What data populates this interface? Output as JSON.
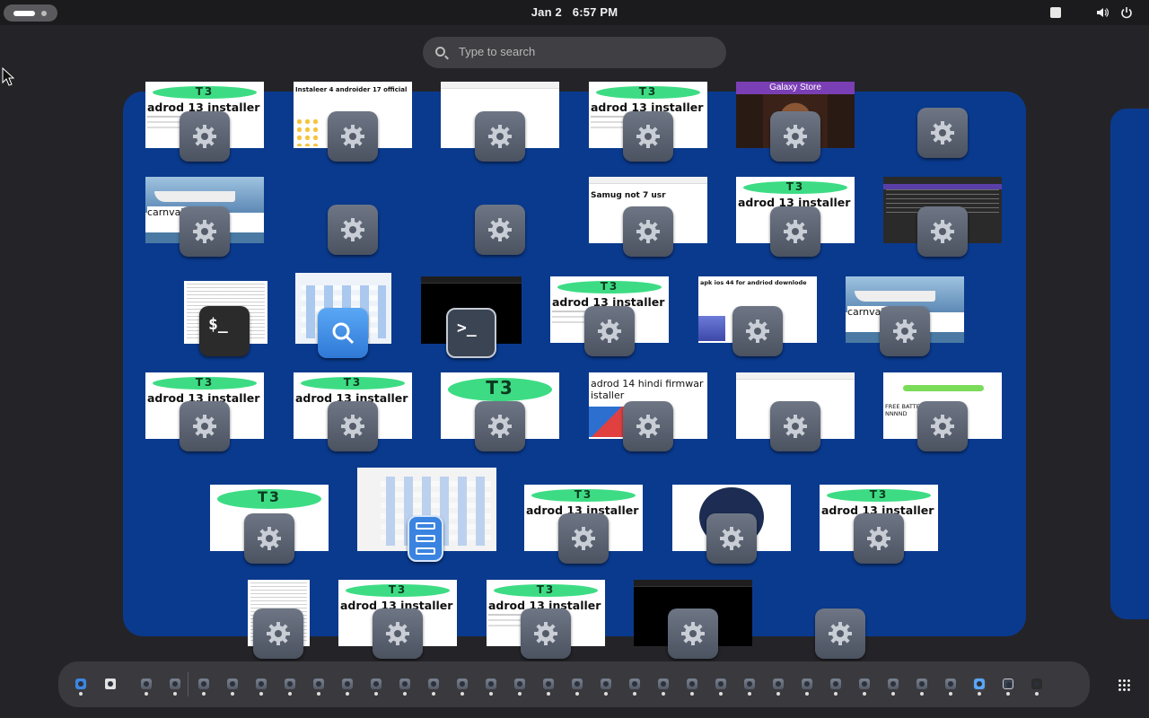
{
  "topbar": {
    "date": "Jan 2",
    "time": "6:57 PM",
    "tray_icons": [
      "keyboard-icon",
      "volume-icon",
      "power-icon"
    ]
  },
  "search": {
    "placeholder": "Type to search"
  },
  "windows": {
    "installer_title": "adrod 13 installer",
    "t13_logo": "T3",
    "w_r1c2": "Instaleer 4 androider 17 official",
    "w_galaxy": "Galaxy Store",
    "w_carnival": "carnval fr",
    "w_samsung": "Samug not 7 usr",
    "w_apk": "apk ios 44 for andriod downlode",
    "w_hindi": "adrod 14 hindi firmwar istaller",
    "w_battery": "FREE BATTE NNNND"
  },
  "colors": {
    "workspace": "#0a3a8e",
    "topbar": "#1b1b1d",
    "dash": "#3a3a3e",
    "android_green": "#3ddc84"
  },
  "dash": {
    "items": [
      "files-icon",
      "software-store-icon",
      "settings-icon",
      "search-icon",
      "terminal-icon",
      "console-icon",
      "show-apps-icon"
    ]
  }
}
